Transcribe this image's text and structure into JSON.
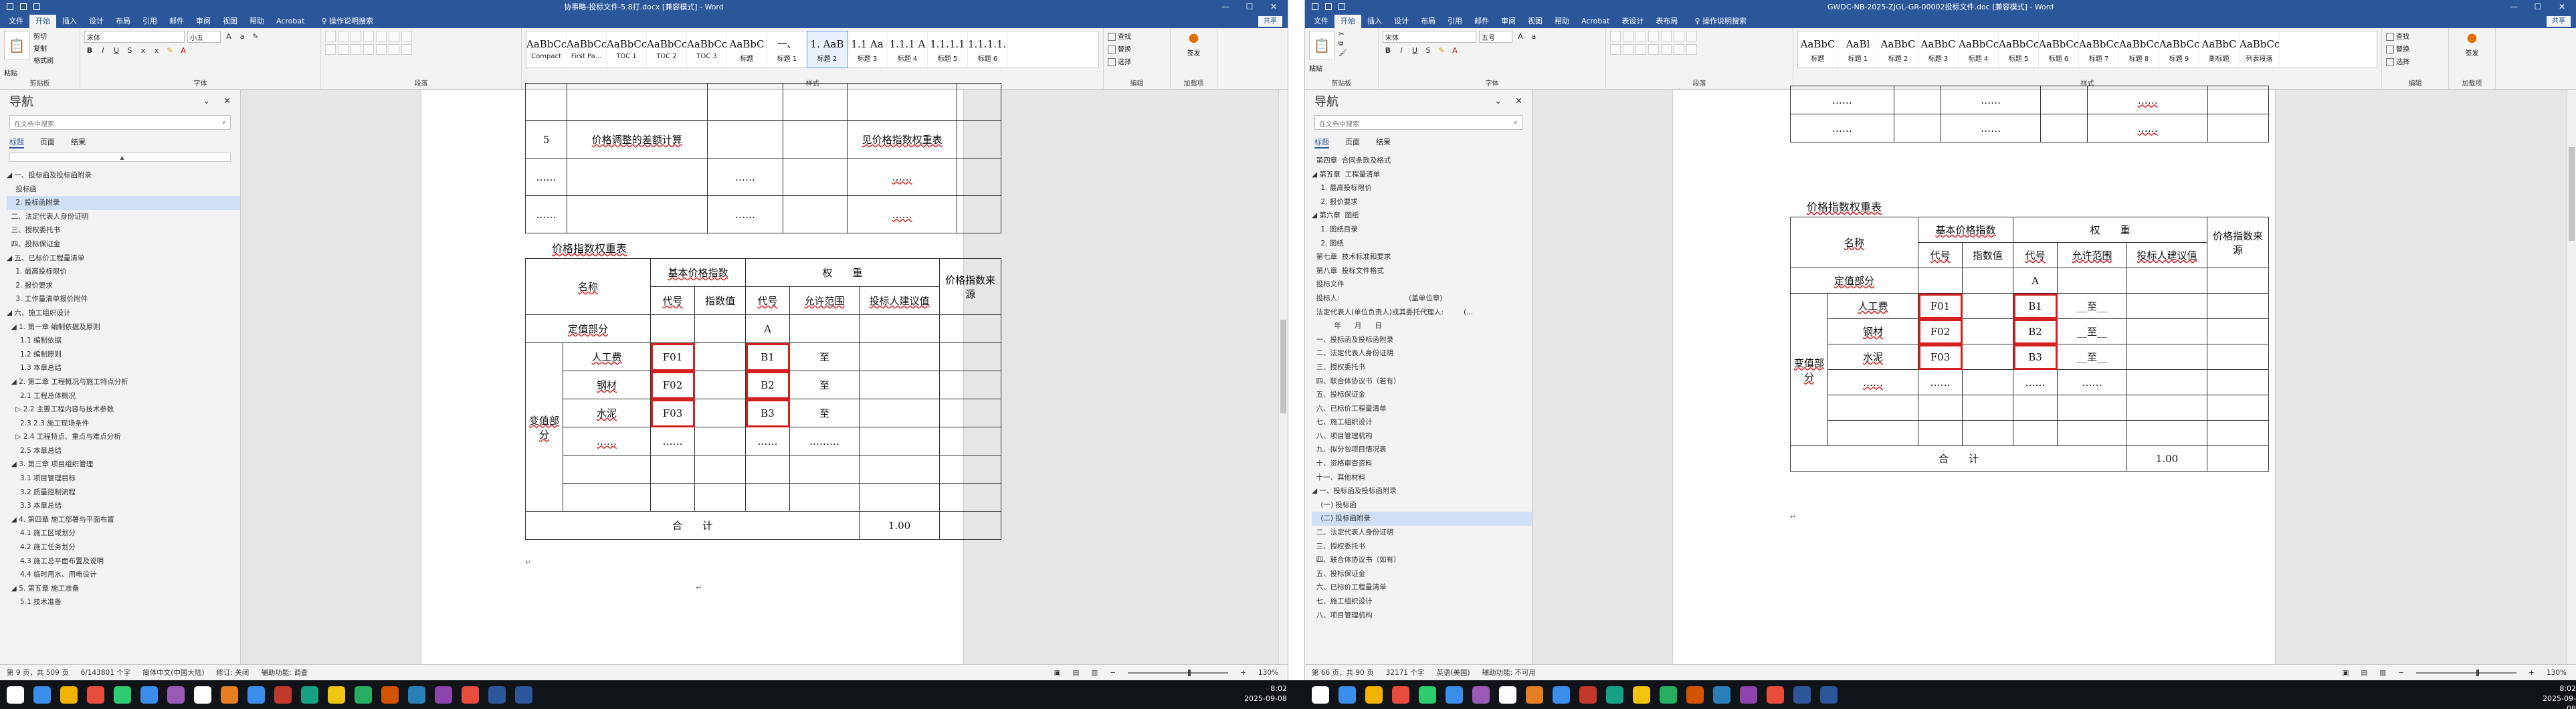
{
  "left": {
    "title": "协事略-投标文件-5.8打.docx [兼容模式] - Word",
    "tabs": [
      "文件",
      "开始",
      "插入",
      "设计",
      "布局",
      "引用",
      "邮件",
      "审阅",
      "视图",
      "帮助",
      "Acrobat"
    ],
    "tell_me": "操作说明搜索",
    "share": "共享",
    "ribbon": {
      "clipboard_label": "剪贴板",
      "paste": "粘贴",
      "cut": "剪切",
      "copy": "复制",
      "format_painter": "格式刷",
      "font_label": "字体",
      "font_name": "宋体",
      "font_size": "小五",
      "paragraph_label": "段落",
      "styles_label": "样式",
      "styles": [
        {
          "preview": "AaBbCcDd",
          "name": "Compact"
        },
        {
          "preview": "AaBbCcDd",
          "name": "First Pa..."
        },
        {
          "preview": "AaBbCcDc",
          "name": "TOC 1"
        },
        {
          "preview": "AaBbCcDc",
          "name": "TOC 2"
        },
        {
          "preview": "AaBbCcDc",
          "name": "TOC 3"
        },
        {
          "preview": "AaBbC",
          "name": "标题"
        },
        {
          "preview": "一、",
          "name": "标题 1"
        },
        {
          "preview": "1. AaB",
          "name": "标题 2"
        },
        {
          "preview": "1.1 Aa",
          "name": "标题 3"
        },
        {
          "preview": "1.1.1 A",
          "name": "标题 4"
        },
        {
          "preview": "1.1.1.1",
          "name": "标题 5"
        },
        {
          "preview": "1.1.1.1.1",
          "name": "标题 6"
        }
      ],
      "find": "查找",
      "replace": "替换",
      "select": "选择",
      "editing_label": "编辑",
      "sign": "签发",
      "sign_sub": "加载项"
    },
    "nav": {
      "title": "导航",
      "search_placeholder": "在文档中搜索",
      "tabs": [
        "标题",
        "页面",
        "结果"
      ],
      "items": [
        "◢ 一、投标函及投标函附录",
        "    投标函",
        "    2. 投标函附录",
        "  二、法定代表人身份证明",
        "  三、授权委托书",
        "  四、投标保证金",
        "◢ 五、已标价工程量清单",
        "    1. 最高投标限价",
        "    2. 报价要求",
        "    3. 工作量清单报价附件",
        "◢ 六、施工组织设计",
        "  ◢ 1. 第一章 编制依据及原则",
        "      1.1 编制依据",
        "      1.2 编制原则",
        "      1.3 本章总结",
        "  ◢ 2. 第二章 工程概况与施工特点分析",
        "      2.1 工程总体概况",
        "    ▷ 2.2 主要工程内容与技术参数",
        "      2.3 2.3 施工现场条件",
        "    ▷ 2.4 工程特点、重点与难点分析",
        "      2.5 本章总结",
        "  ◢ 3. 第三章 项目组织管理",
        "      3.1 项目管理目标",
        "      3.2 质量控制流程",
        "      3.3 本章总结",
        "  ◢ 4. 第四章 施工部署与平面布置",
        "      4.1 施工区域划分",
        "      4.2 施工任务划分",
        "      4.3 施工总平面布置及说明",
        "      4.4 临时用水、用电设计",
        "  ◢ 5. 第五章 施工准备",
        "      5.1 技术准备"
      ],
      "selected_index": 2
    },
    "doc": {
      "top_rows": [
        [
          "",
          "",
          "",
          "",
          "",
          ""
        ],
        [
          "5",
          "价格调整的差额计算",
          "",
          "",
          "见价格指数权重表",
          ""
        ],
        [
          "……",
          "",
          "……",
          "",
          "……",
          ""
        ],
        [
          "……",
          "",
          "……",
          "",
          "……",
          ""
        ]
      ],
      "caption": "价格指数权重表",
      "h_name": "名称",
      "h_base": "基本价格指数",
      "h_weight": "权　　重",
      "h_source": "价格指数来源",
      "h_code": "代号",
      "h_index": "指数值",
      "h_code2": "代号",
      "h_range": "允许范围",
      "h_bid": "投标人建议值",
      "fixed_part": "定值部分",
      "fixed_code": "A",
      "var_part": "变值部分",
      "rows": [
        {
          "name": "人工费",
          "code": "F01",
          "code2": "B1",
          "range": "至"
        },
        {
          "name": "钢材",
          "code": "F02",
          "code2": "B2",
          "range": "至"
        },
        {
          "name": "水泥",
          "code": "F03",
          "code2": "B3",
          "range": "至"
        },
        {
          "name": "……",
          "code": "……",
          "code2": "……",
          "range": "………"
        }
      ],
      "total_label": "合　　计",
      "total_value": "1.00"
    },
    "status": {
      "page": "第 9 页，共 509 页",
      "words": "6/143801 个字",
      "lang": "简体中文(中国大陆)",
      "track": "修订: 关闭",
      "access": "辅助功能: 调查",
      "zoom": "130%"
    }
  },
  "right": {
    "title": "GWDC-NB-2025-ZJGL-GR-00002投标文件.doc [兼容模式] - Word",
    "tabs": [
      "文件",
      "开始",
      "插入",
      "设计",
      "布局",
      "引用",
      "邮件",
      "审阅",
      "视图",
      "帮助",
      "Acrobat",
      "表设计",
      "表布局"
    ],
    "table_tools": "表格工具",
    "tell_me": "操作说明搜索",
    "share": "共享",
    "ribbon": {
      "clipboard_label": "剪贴板",
      "paste": "粘贴",
      "font_label": "字体",
      "font_name": "宋体",
      "font_size": "五号",
      "paragraph_label": "段落",
      "styles_label": "样式",
      "styles": [
        {
          "preview": "AaBbC",
          "name": "标题"
        },
        {
          "preview": "AaBl",
          "name": "标题 1"
        },
        {
          "preview": "AaBbC",
          "name": "标题 2"
        },
        {
          "preview": "AaBbC",
          "name": "标题 3"
        },
        {
          "preview": "AaBbCcD",
          "name": "标题 4"
        },
        {
          "preview": "AaBbCcD",
          "name": "标题 5"
        },
        {
          "preview": "AaBbCcDd",
          "name": "标题 6"
        },
        {
          "preview": "AaBbCcDd",
          "name": "标题 7"
        },
        {
          "preview": "AaBbCcDd",
          "name": "标题 8"
        },
        {
          "preview": "AaBbCcDd",
          "name": "标题 9"
        },
        {
          "preview": "AaBbC",
          "name": "副标题"
        },
        {
          "preview": "AaBbCcDd",
          "name": "列表段落"
        }
      ],
      "find": "查找",
      "replace": "替换",
      "select": "选择",
      "editing_label": "编辑",
      "sign": "签发",
      "sign_sub": "加载项"
    },
    "nav": {
      "title": "导航",
      "search_placeholder": "在文档中搜索",
      "tabs": [
        "标题",
        "页面",
        "结果"
      ],
      "items": [
        "  第四章  合同条款及格式",
        "◢ 第五章  工程量清单",
        "    1. 最高投标限价",
        "    2. 报价要求",
        "◢ 第六章  图纸",
        "    1. 图纸目录",
        "    2. 图纸",
        "  第七章  技术标准和要求",
        "  第八章  投标文件格式",
        "  投标文件",
        "  投标人:                               (盖单位章)",
        "  法定代表人(单位负责人)或其委托代理人:         (...",
        "          年      月      日",
        "  一、投标函及投标函附录",
        "  二、法定代表人身份证明",
        "  三、授权委托书",
        "  四、联合体协议书（若有）",
        "  五、投标保证金",
        "  六、已标价工程量清单",
        "  七、施工组织设计",
        "  八、项目管理机构",
        "  九、拟分包项目情况表",
        "  十、资格审查资料",
        "  十一、其他材料",
        "◢ 一、投标函及投标函附录",
        "    (一) 投标函",
        "    (二) 投标函附录",
        "  二、法定代表人身份证明",
        "  三、授权委托书",
        "  四、联合体协议书（如有）",
        "  五、投标保证金",
        "  六、已标价工程量清单",
        "  七、施工组织设计",
        "  八、项目管理机构"
      ],
      "selected_index": 26
    },
    "doc": {
      "top_rows": [
        [
          "……",
          "",
          "……",
          "",
          "……",
          ""
        ],
        [
          "……",
          "",
          "……",
          "",
          "……",
          ""
        ]
      ],
      "caption": "价格指数权重表",
      "h_name": "名称",
      "h_base": "基本价格指数",
      "h_weight": "权　　重",
      "h_source": "价格指数来源",
      "h_code": "代号",
      "h_index": "指数值",
      "h_code2": "代号",
      "h_range": "允许范围",
      "h_bid": "投标人建议值",
      "fixed_part": "定值部分",
      "fixed_code": "A",
      "var_part": "变值部分",
      "rows": [
        {
          "name": "人工费",
          "code": "F01",
          "code2": "B1",
          "range": "__至__"
        },
        {
          "name": "钢材",
          "code": "F02",
          "code2": "B2",
          "range": "__至__"
        },
        {
          "name": "水泥",
          "code": "F03",
          "code2": "B3",
          "range": "__至__"
        },
        {
          "name": "……",
          "code": "……",
          "code2": "……",
          "range": "……"
        }
      ],
      "total_label": "合　　计",
      "total_value": "1.00"
    },
    "status": {
      "page": "第 66 页，共 90 页",
      "words": "32171 个字",
      "lang": "英语(美国)",
      "access": "辅助功能: 不可用",
      "zoom": "130%"
    }
  },
  "taskbar": {
    "time": "8:02",
    "date": "2025-09-08"
  }
}
